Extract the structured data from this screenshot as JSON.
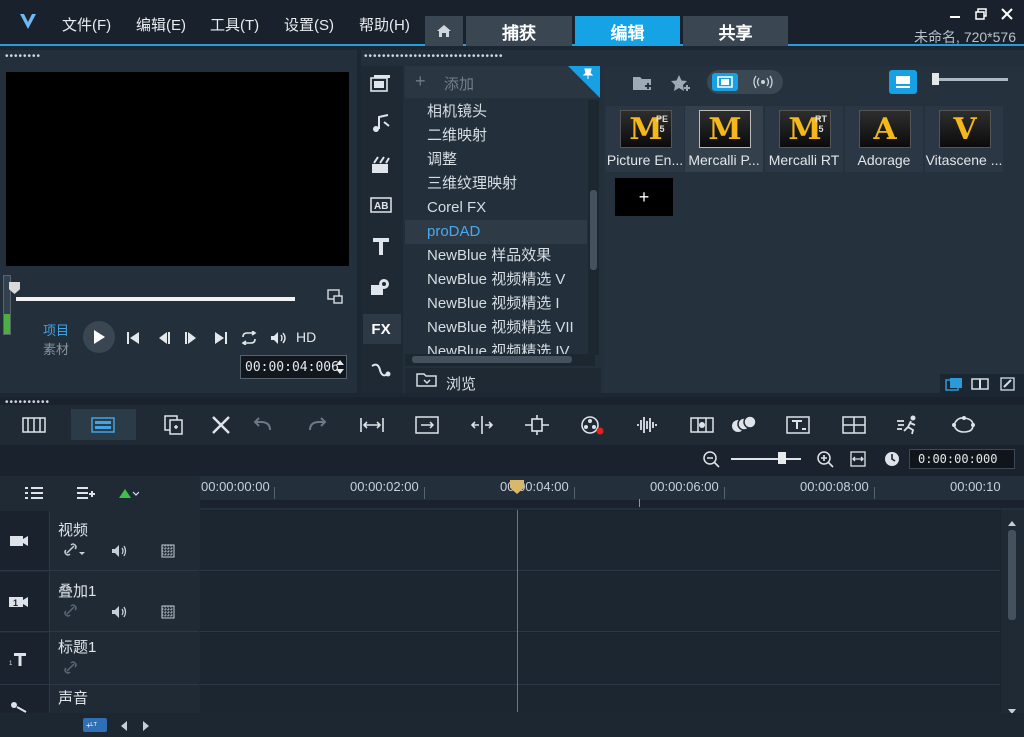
{
  "app": {
    "menu": [
      {
        "label": "文件(F)"
      },
      {
        "label": "编辑(E)"
      },
      {
        "label": "工具(T)"
      },
      {
        "label": "设置(S)"
      },
      {
        "label": "帮助(H)"
      }
    ],
    "tabs": [
      {
        "label": "捕获"
      },
      {
        "label": "编辑",
        "active": true
      },
      {
        "label": "共享"
      }
    ],
    "project_info": "未命名, 720*576",
    "accent_color": "#18a0e4"
  },
  "player": {
    "mode_project": "项目",
    "mode_clip": "素材",
    "hd_label": "HD",
    "timecode": "00:00:04:006",
    "volume_level": 0.35
  },
  "library": {
    "add_label": "添加",
    "browse_label": "浏览",
    "categories": [
      {
        "label": "相机镜头"
      },
      {
        "label": "二维映射"
      },
      {
        "label": "调整"
      },
      {
        "label": "三维纹理映射"
      },
      {
        "label": "Corel FX"
      },
      {
        "label": "proDAD",
        "selected": true
      },
      {
        "label": "NewBlue 样品效果"
      },
      {
        "label": "NewBlue 视频精选 V"
      },
      {
        "label": "NewBlue 视频精选 I"
      },
      {
        "label": "NewBlue 视频精选 VII"
      },
      {
        "label": "NewBlue 视频精选 IV"
      }
    ],
    "effects": [
      {
        "caption": "Picture En...",
        "glyph": "M",
        "version": "PE 5"
      },
      {
        "caption": "Mercalli P...",
        "glyph": "M",
        "version": ""
      },
      {
        "caption": "Mercalli RT",
        "glyph": "M",
        "version": "RT 5"
      },
      {
        "caption": "Adorage",
        "glyph": "A",
        "version": ""
      },
      {
        "caption": "Vitascene ...",
        "glyph": "V",
        "version": ""
      }
    ],
    "add_tile": "+"
  },
  "timeline": {
    "timecode": "0:00:00:000",
    "ruler": [
      "00:00:00:00",
      "00:00:02:00",
      "00:00:04:00",
      "00:00:06:00",
      "00:00:08:00",
      "00:00:10"
    ],
    "tracks": [
      {
        "name": "视频"
      },
      {
        "name": "叠加1"
      },
      {
        "name": "标题1"
      },
      {
        "name": "声音"
      }
    ]
  }
}
